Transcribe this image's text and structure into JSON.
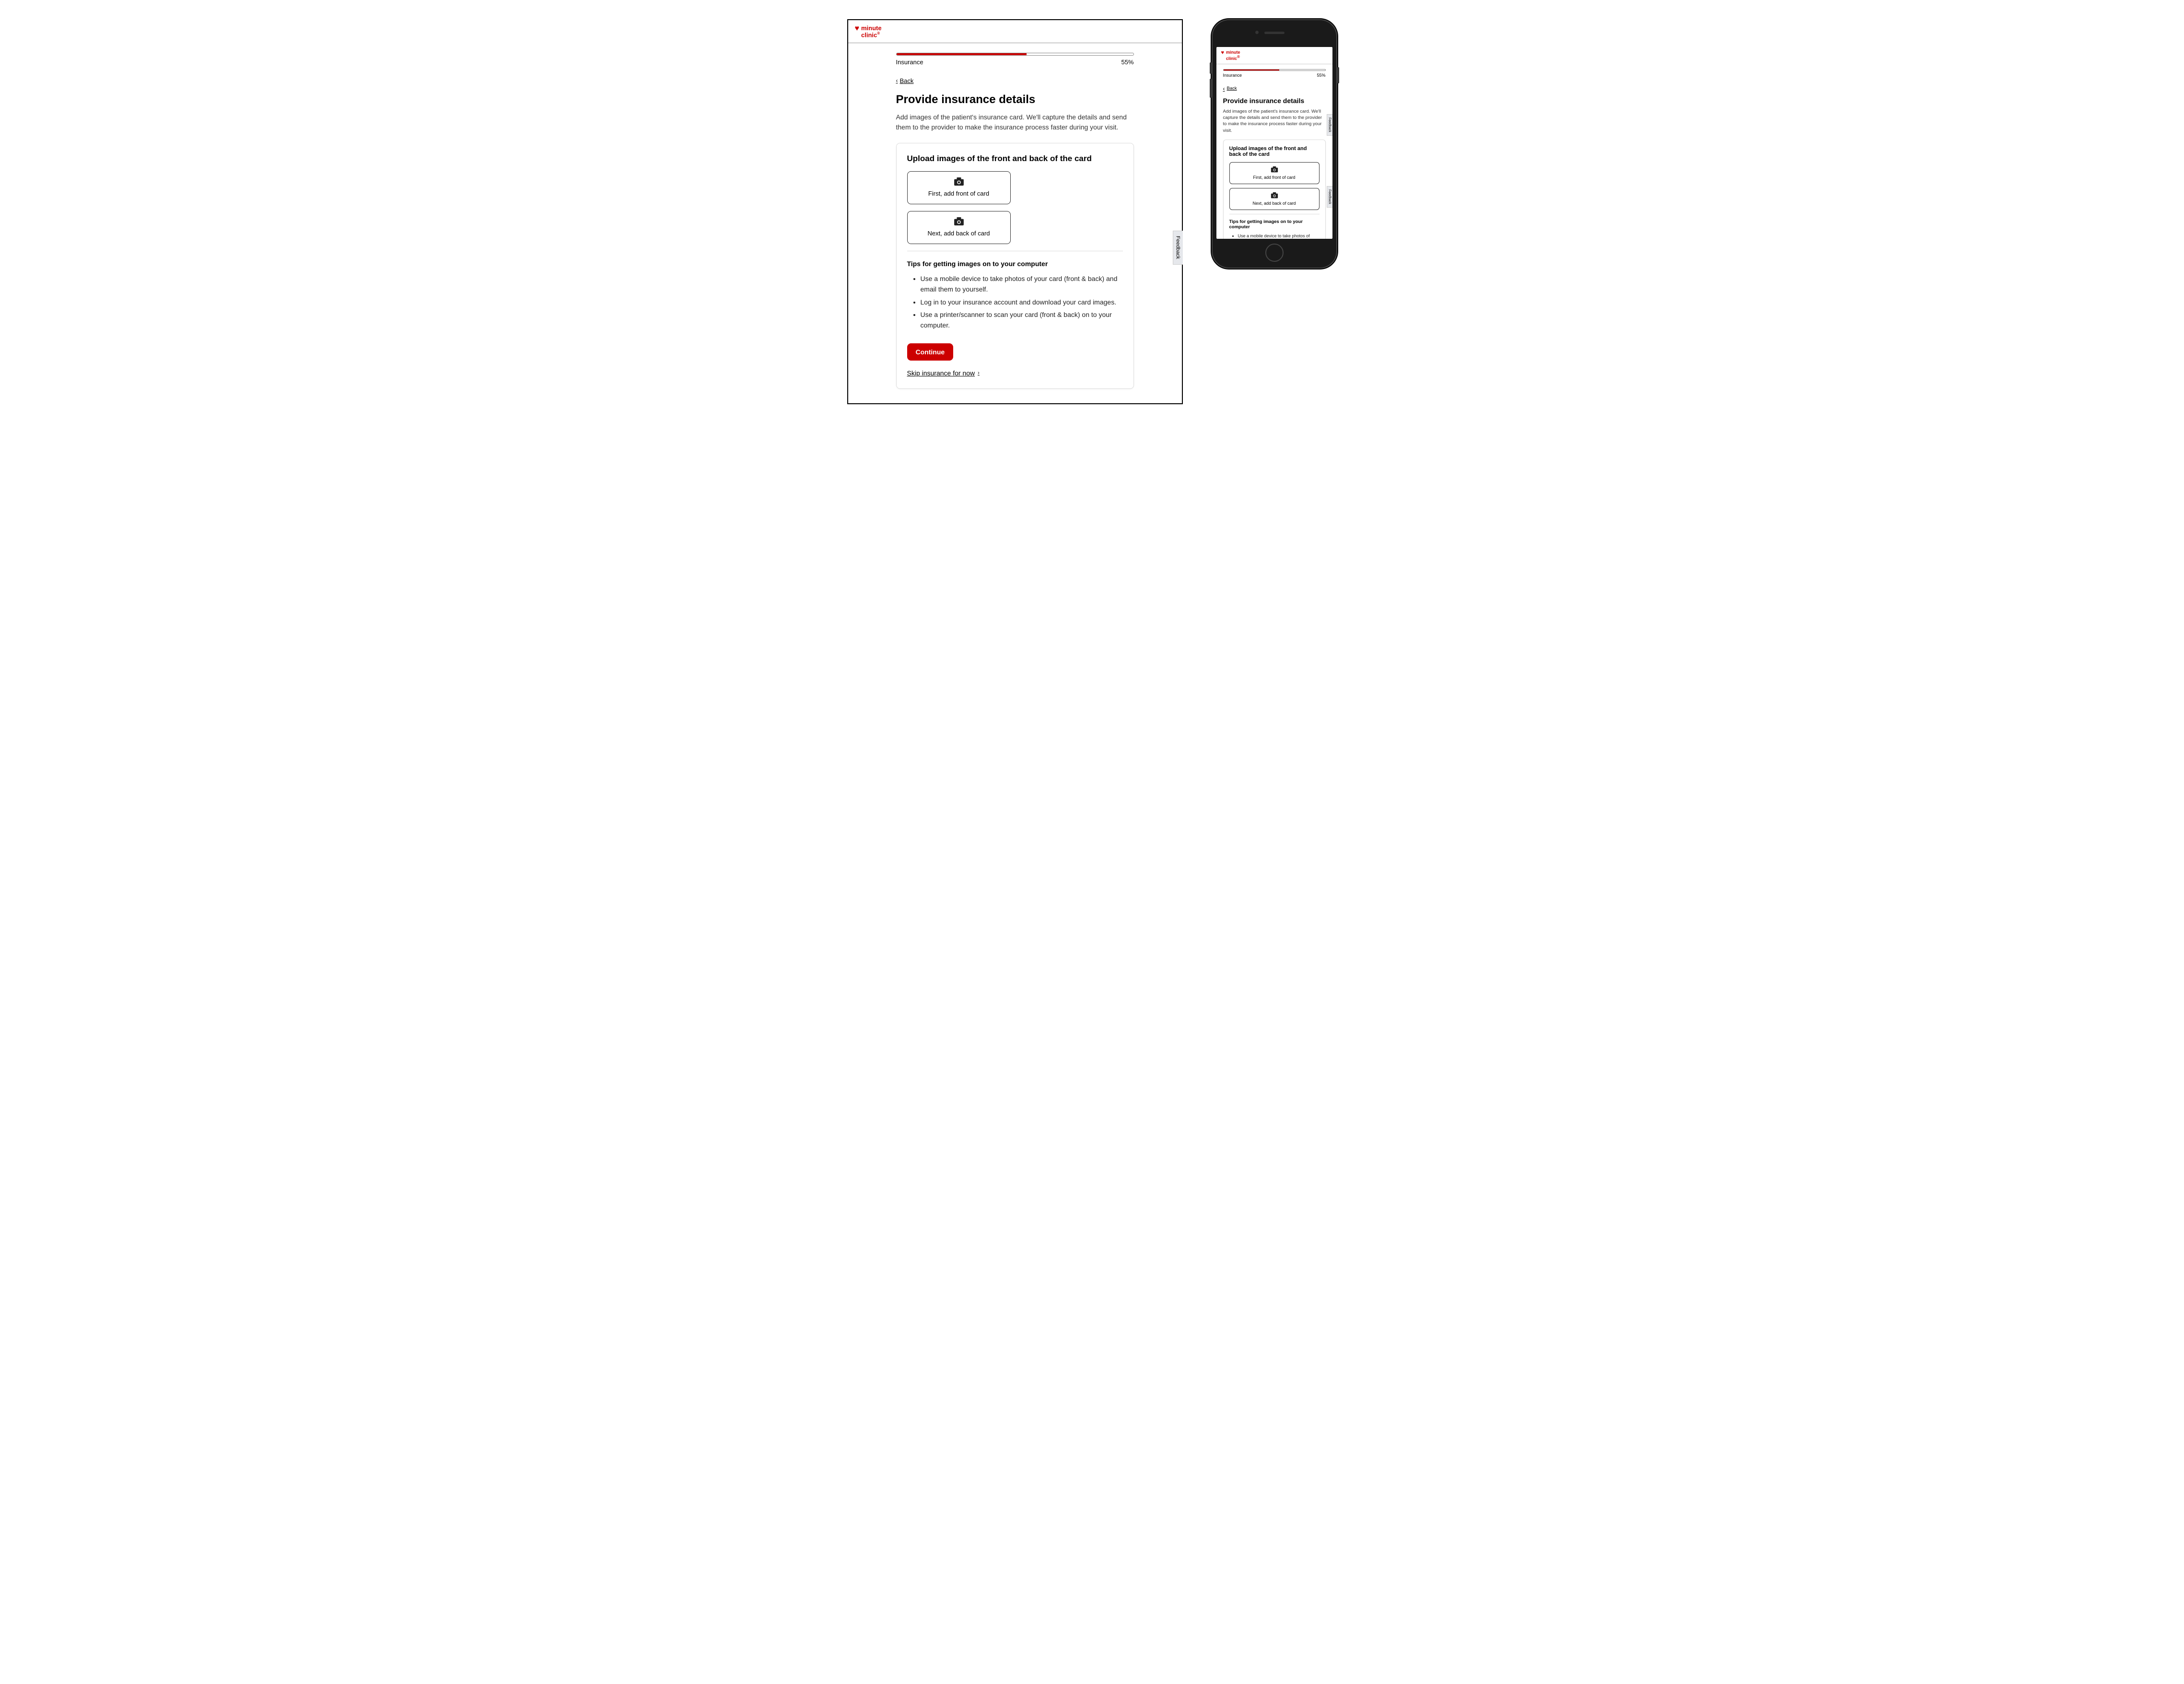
{
  "brand": {
    "name_line1": "minute",
    "name_line2": "clinic",
    "trademark": "®"
  },
  "progress": {
    "label": "Insurance",
    "percent_text": "55%",
    "percent_value": 55
  },
  "back": {
    "label": "Back"
  },
  "page": {
    "title": "Provide insurance details",
    "description": "Add images of the patient's insurance card. We'll capture the details and send them to the provider to make the insurance process faster during your visit."
  },
  "upload_card": {
    "heading": "Upload images of the front and back of the card",
    "front_label": "First, add front of card",
    "back_label": "Next, add back of card"
  },
  "tips": {
    "heading": "Tips for getting images on to your computer",
    "items": [
      "Use a mobile device to take photos of your card (front & back) and email them to yourself.",
      "Log in to your insurance account and download your card images.",
      "Use a printer/scanner to scan your card (front & back) on to your computer."
    ]
  },
  "actions": {
    "continue": "Continue",
    "skip": "Skip insurance for now"
  },
  "feedback": {
    "label": "Feedback"
  }
}
